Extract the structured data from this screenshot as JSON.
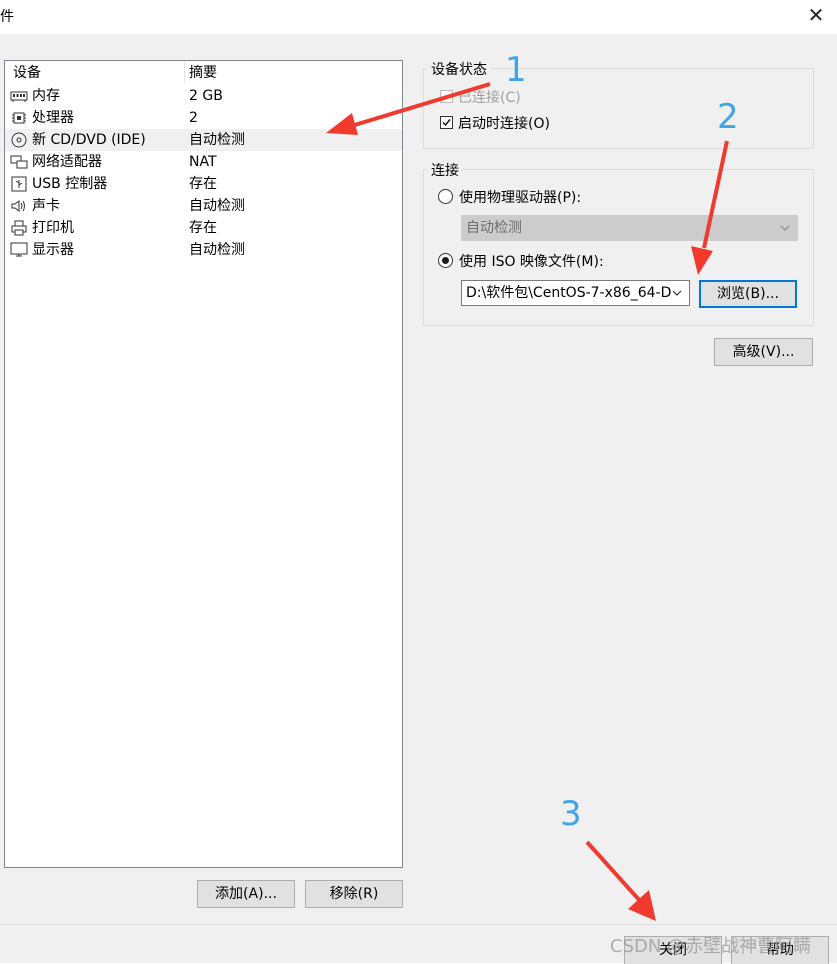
{
  "window": {
    "title": "硬件",
    "close_glyph": "✕"
  },
  "device_list": {
    "headers": {
      "device": "设备",
      "summary": "摘要"
    },
    "rows": [
      {
        "name": "内存",
        "summary": "2 GB",
        "icon": "memory-icon"
      },
      {
        "name": "处理器",
        "summary": "2",
        "icon": "processor-icon"
      },
      {
        "name": "新 CD/DVD (IDE)",
        "summary": "自动检测",
        "icon": "cd-dvd-icon",
        "selected": true
      },
      {
        "name": "网络适配器",
        "summary": "NAT",
        "icon": "network-adapter-icon"
      },
      {
        "name": "USB 控制器",
        "summary": "存在",
        "icon": "usb-icon"
      },
      {
        "name": "声卡",
        "summary": "自动检测",
        "icon": "sound-card-icon"
      },
      {
        "name": "打印机",
        "summary": "存在",
        "icon": "printer-icon"
      },
      {
        "name": "显示器",
        "summary": "自动检测",
        "icon": "display-icon"
      }
    ],
    "add_label": "添加(A)...",
    "remove_label": "移除(R)"
  },
  "device_status": {
    "title": "设备状态",
    "connected_label": "已连接(C)",
    "connected_checked": false,
    "connect_on_power_label": "启动时连接(O)",
    "connect_on_power_checked": true
  },
  "connection": {
    "title": "连接",
    "physical_drive_label": "使用物理驱动器(P):",
    "physical_drive_value": "自动检测",
    "iso_label": "使用 ISO 映像文件(M):",
    "iso_value": "D:\\软件包\\CentOS-7-x86_64-D",
    "selected": "iso",
    "browse_label": "浏览(B)..."
  },
  "advanced_label": "高级(V)...",
  "footer": {
    "close_label": "关闭",
    "help_label": "帮助"
  },
  "annotations": {
    "one": "1",
    "two": "2",
    "three": "3",
    "arrow_color": "#f03a2e"
  },
  "watermark": "CSDN @赤壁战神曹阿瞒"
}
